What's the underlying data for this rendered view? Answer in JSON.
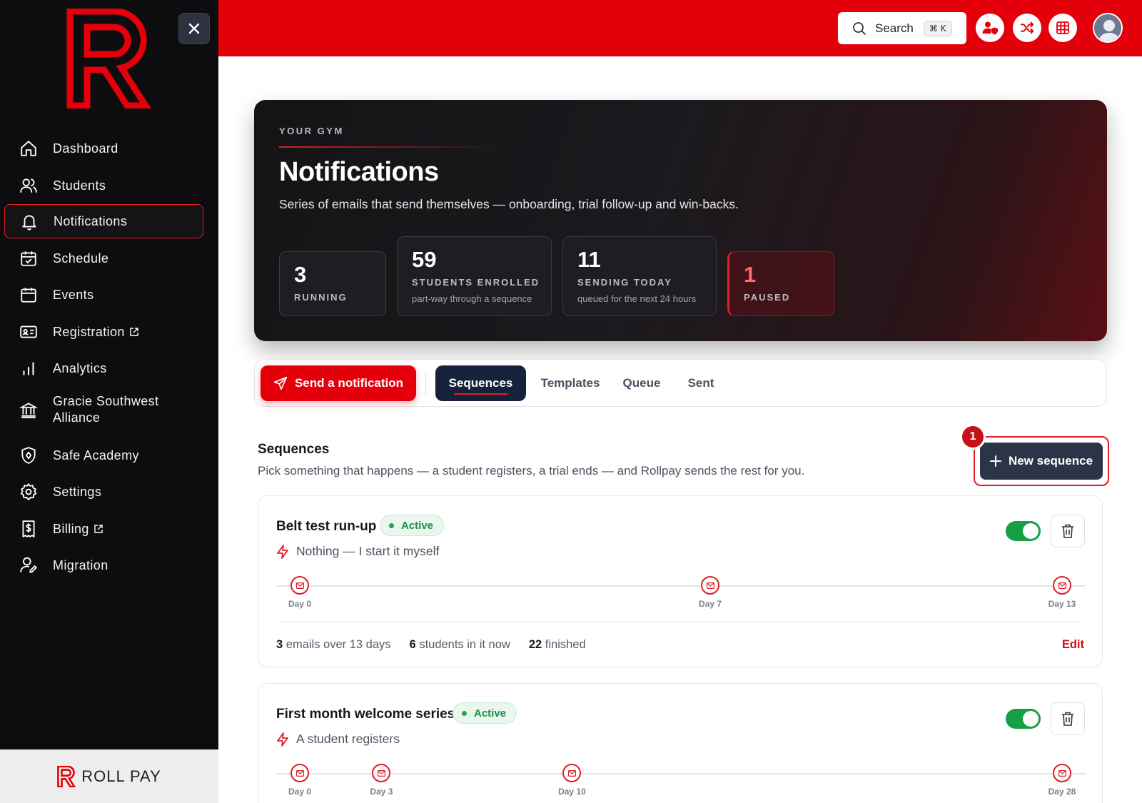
{
  "brand": {
    "name": "ROLL PAY",
    "accent": "#e3000b",
    "sidebar_bg": "#0d0d0f"
  },
  "sidebar": {
    "items": [
      {
        "label": "Dashboard",
        "icon": "home-icon"
      },
      {
        "label": "Students",
        "icon": "users-icon"
      },
      {
        "label": "Notifications",
        "icon": "bell-icon",
        "active": true
      },
      {
        "label": "Schedule",
        "icon": "calendar-check-icon"
      },
      {
        "label": "Events",
        "icon": "calendar-icon"
      },
      {
        "label": "Registration",
        "icon": "id-card-icon",
        "external": true
      },
      {
        "label": "Analytics",
        "icon": "bar-chart-icon"
      },
      {
        "label": "Gracie Southwest Alliance",
        "icon": "bank-icon"
      },
      {
        "label": "Safe Academy",
        "icon": "shield-icon"
      },
      {
        "label": "Settings",
        "icon": "gear-icon"
      },
      {
        "label": "Billing",
        "icon": "receipt-dollar-icon",
        "external": true
      },
      {
        "label": "Migration",
        "icon": "user-edit-icon"
      }
    ]
  },
  "topbar": {
    "search_label": "Search",
    "search_shortcut": "⌘ K"
  },
  "hero": {
    "eyebrow": "YOUR GYM",
    "title": "Notifications",
    "subtitle": "Series of emails that send themselves — onboarding, trial follow-up and win-backs.",
    "stats": [
      {
        "value": "3",
        "label": "RUNNING"
      },
      {
        "value": "59",
        "label": "STUDENTS ENROLLED",
        "desc": "part-way through a sequence"
      },
      {
        "value": "11",
        "label": "SENDING TODAY",
        "desc": "queued for the next 24 hours"
      },
      {
        "value": "1",
        "label": "PAUSED"
      }
    ]
  },
  "tabs": {
    "send_label": "Send a notification",
    "items": [
      "Sequences",
      "Templates",
      "Queue",
      "Sent"
    ],
    "active": "Sequences"
  },
  "sequences": {
    "title": "Sequences",
    "subtitle": "Pick something that happens — a student registers, a trial ends — and Rollpay sends the rest for you.",
    "new_label": "New sequence",
    "badge": "1",
    "cards": [
      {
        "title": "Belt test run-up",
        "status": "Active",
        "enabled": true,
        "trigger": "Nothing — I start it myself",
        "steps": [
          {
            "day": 0,
            "label": "Day 0"
          },
          {
            "day": 7,
            "label": "Day 7"
          },
          {
            "day": 13,
            "label": "Day 13"
          }
        ],
        "span_days": 13,
        "meta": {
          "emails_count": "3",
          "emails_text": "emails over 13 days",
          "students_count": "6",
          "students_text": "students in it now",
          "finished_count": "22",
          "finished_text": "finished"
        },
        "edit_label": "Edit"
      },
      {
        "title": "First month welcome series",
        "status": "Active",
        "enabled": true,
        "trigger": "A student registers",
        "steps": [
          {
            "day": 0,
            "label": "Day 0"
          },
          {
            "day": 3,
            "label": "Day 3"
          },
          {
            "day": 10,
            "label": "Day 10"
          },
          {
            "day": 28,
            "label": "Day 28"
          }
        ],
        "span_days": 28
      }
    ]
  }
}
